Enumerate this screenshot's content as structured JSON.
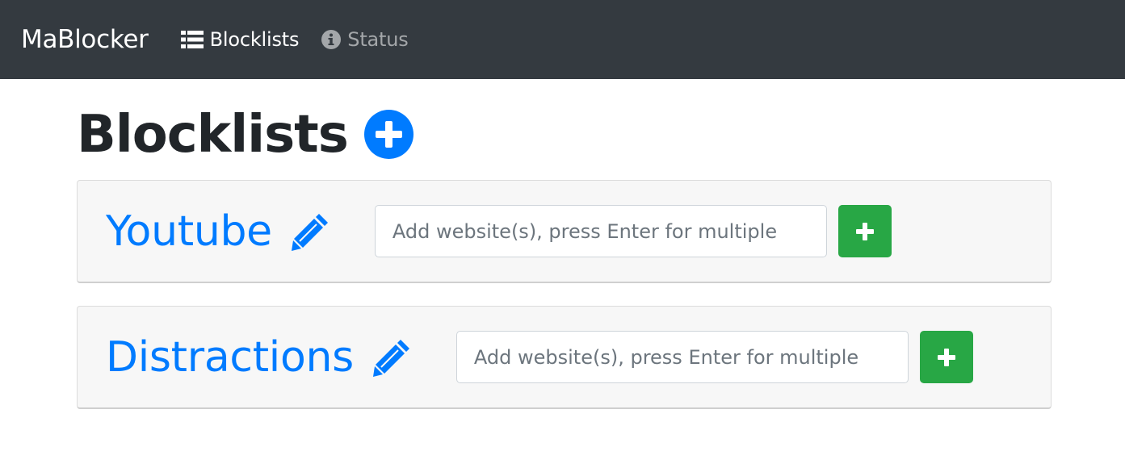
{
  "navbar": {
    "brand": "MaBlocker",
    "links": [
      {
        "label": "Blocklists",
        "icon": "list-icon",
        "active": true
      },
      {
        "label": "Status",
        "icon": "info-circle-icon",
        "active": false
      }
    ]
  },
  "page": {
    "title": "Blocklists",
    "add_icon": "plus-circle-icon"
  },
  "blocklists": [
    {
      "name": "Youtube",
      "edit_icon": "pencil-icon",
      "input_placeholder": "Add website(s), press Enter for multiple",
      "add_icon": "plus-icon"
    },
    {
      "name": "Distractions",
      "edit_icon": "pencil-icon",
      "input_placeholder": "Add website(s), press Enter for multiple",
      "add_icon": "plus-icon"
    }
  ],
  "colors": {
    "navbar_bg": "#343a40",
    "link_primary": "#007bff",
    "success": "#28a745",
    "card_bg": "#f7f7f7"
  }
}
